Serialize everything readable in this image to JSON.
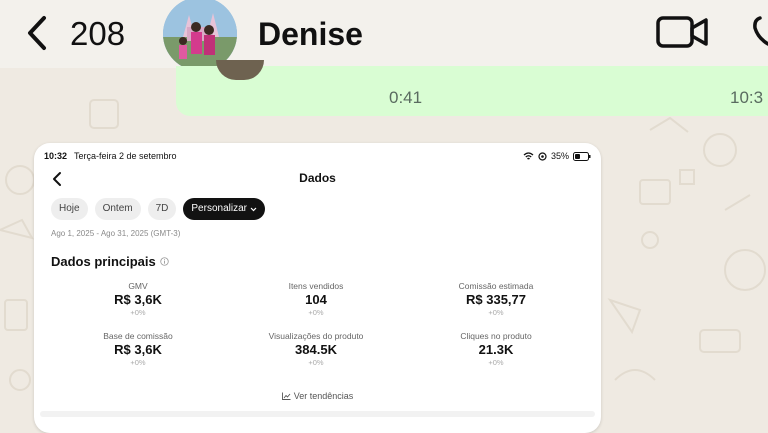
{
  "header": {
    "back_icon": "chevron-left-icon",
    "unread_count": "208",
    "contact_name": "Denise",
    "video_icon": "video-camera-icon",
    "call_icon": "phone-icon"
  },
  "message": {
    "voice_duration": "0:41",
    "time": "10:3"
  },
  "screenshot": {
    "status_time": "10:32",
    "status_date": "Terça-feira 2 de setembro",
    "battery": "35%",
    "title": "Dados",
    "filters": [
      "Hoje",
      "Ontem",
      "7D",
      "Personalizar"
    ],
    "active_filter": "Personalizar",
    "date_range": "Ago 1, 2025 - Ago 31, 2025 (GMT-3)",
    "section_title": "Dados principais",
    "metrics": [
      {
        "label": "GMV",
        "value": "R$ 3,6K",
        "change": "+0%"
      },
      {
        "label": "Itens vendidos",
        "value": "104",
        "change": "+0%"
      },
      {
        "label": "Comissão estimada",
        "value": "R$ 335,77",
        "change": "+0%"
      },
      {
        "label": "Base de comissão",
        "value": "R$ 3,6K",
        "change": "+0%"
      },
      {
        "label": "Visualizações do produto",
        "value": "384.5K",
        "change": "+0%"
      },
      {
        "label": "Cliques no produto",
        "value": "21.3K",
        "change": "+0%"
      }
    ],
    "trends_link": "Ver tendências"
  },
  "colors": {
    "chat_background": "#efeae2",
    "bubble": "#d9fdd3",
    "active_chip": "#121212"
  }
}
